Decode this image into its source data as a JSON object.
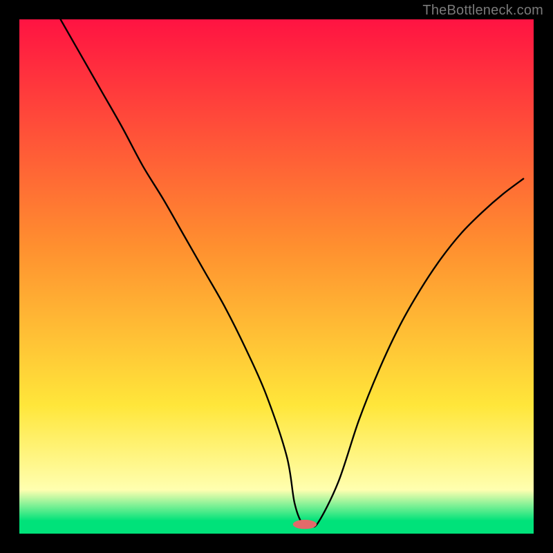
{
  "attribution": "TheBottleneck.com",
  "colors": {
    "top": "#ff1342",
    "mid_orange": "#ff8f2f",
    "mid_yellow": "#ffe63a",
    "pale_yellow": "#ffffb0",
    "green": "#00e27a",
    "curve": "#000000",
    "marker": "#e26a6a",
    "frame": "#000000"
  },
  "chart_data": {
    "type": "line",
    "title": "",
    "xlabel": "",
    "ylabel": "",
    "xlim": [
      0,
      100
    ],
    "ylim": [
      0,
      100
    ],
    "x": [
      8,
      12,
      16,
      20,
      24,
      28,
      32,
      36,
      40,
      44,
      48,
      52,
      53.5,
      55,
      56.5,
      58,
      62,
      66,
      70,
      74,
      78,
      82,
      86,
      90,
      94,
      98
    ],
    "values": [
      100,
      93,
      86,
      79,
      71.5,
      65,
      58,
      51,
      44,
      36,
      27,
      15,
      6,
      2,
      1.8,
      2,
      10,
      22,
      32,
      40.5,
      47.5,
      53.5,
      58.5,
      62.5,
      66,
      69
    ],
    "marker": {
      "x_center": 55.5,
      "y_center": 1.8,
      "rx": 2.3,
      "ry": 0.9
    },
    "gradient_stops": [
      {
        "offset": 0.0,
        "color_key": "top"
      },
      {
        "offset": 0.44,
        "color_key": "mid_orange"
      },
      {
        "offset": 0.75,
        "color_key": "mid_yellow"
      },
      {
        "offset": 0.915,
        "color_key": "pale_yellow"
      },
      {
        "offset": 0.975,
        "color_key": "green"
      },
      {
        "offset": 1.0,
        "color_key": "green"
      }
    ]
  }
}
